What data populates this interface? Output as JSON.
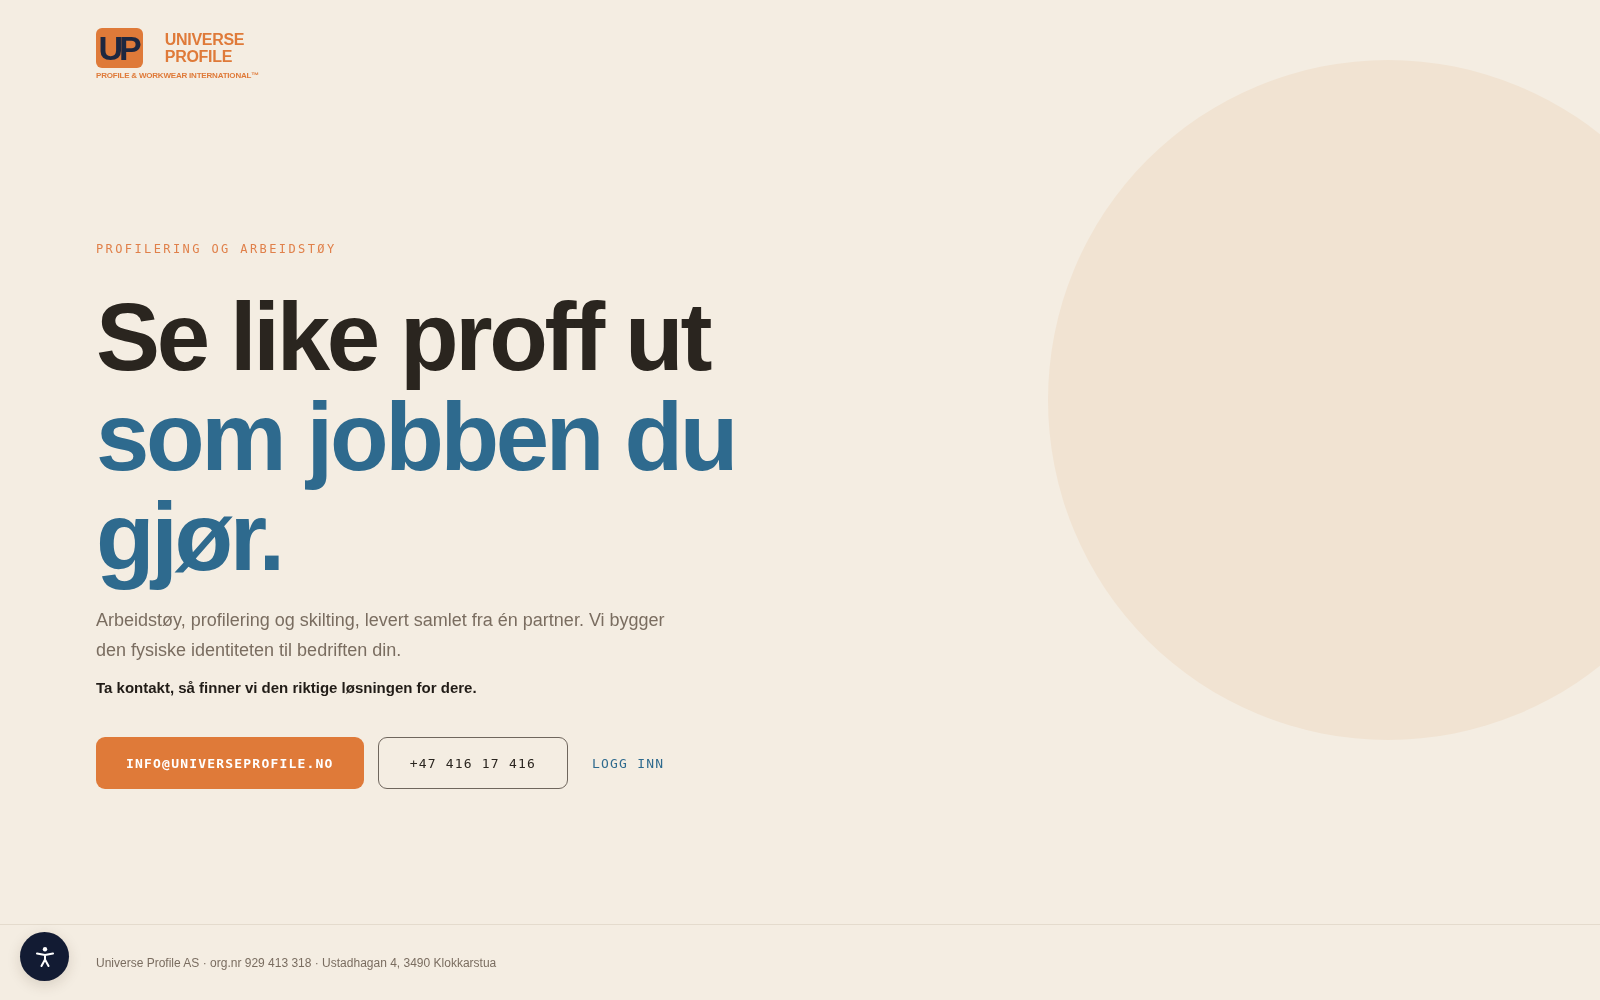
{
  "logo": {
    "mark": "UP",
    "name_lines": [
      "UNIVERSE",
      "PROFILE"
    ],
    "tagline": "PROFILE & WORKWEAR INTERNATIONAL™"
  },
  "hero": {
    "eyebrow": "PROFILERING OG ARBEIDSTØY",
    "headline": [
      {
        "text": "Se like proff ut",
        "accent": false
      },
      {
        "text": "som jobben du gjør.",
        "accent": true
      }
    ],
    "intro": "Arbeidstøy, profilering og skilting, levert samlet fra én partner. Vi bygger den fysiske identiteten til bedriften din.",
    "call_to_action": "Ta kontakt, så finner vi den riktige løsningen for dere.",
    "actions": [
      {
        "kind": "primary",
        "label": "INFO@UNIVERSEPROFILE.NO"
      },
      {
        "kind": "outline",
        "label": "+47 416 17 416"
      },
      {
        "kind": "link",
        "label": "LOGG INN"
      }
    ]
  },
  "footer": {
    "text": "Universe Profile AS · org.nr 929 413 318 · Ustadhagan 4, 3490 Klokkarstua"
  }
}
